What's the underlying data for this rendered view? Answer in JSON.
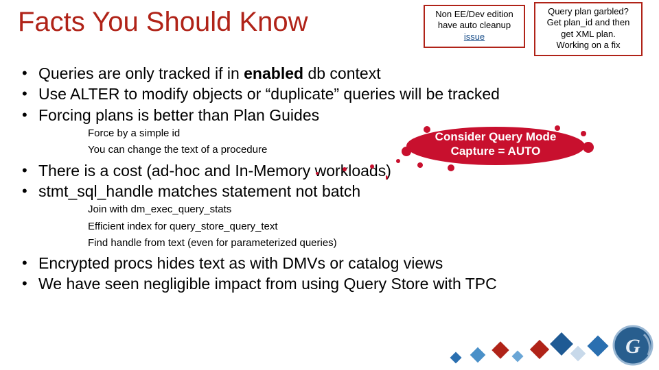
{
  "title": "Facts You Should Know",
  "callouts": {
    "ee_cleanup": {
      "line1": "Non EE/Dev edition",
      "line2": "have auto cleanup",
      "link": "issue"
    },
    "query_plan": {
      "line1": "Query plan garbled?",
      "line2": "Get plan_id and then",
      "line3": "get XML plan.",
      "line4": "Working on a fix"
    }
  },
  "splat": {
    "line1": "Consider Query Mode",
    "line2": "Capture = AUTO"
  },
  "bullets": {
    "b1_pre": "Queries are only tracked if in ",
    "b1_bold": "enabled",
    "b1_post": " db context",
    "b2": "Use ALTER to modify objects or “duplicate” queries will be tracked",
    "b3": "Forcing plans is better than Plan Guides",
    "b3_sub1": "Force by a simple id",
    "b3_sub2": "You can change the text of a procedure",
    "b4": "There is a cost (ad-hoc and In-Memory workloads)",
    "b5": "stmt_sql_handle matches statement not batch",
    "b5_sub1": "Join with dm_exec_query_stats",
    "b5_sub2": "Efficient index for query_store_query_text",
    "b5_sub3": "Find handle from text (even for parameterized queries)",
    "b6": "Encrypted procs hides text as with DMVs or catalog views",
    "b7": "We have seen negligible impact from using Query Store with TPC"
  }
}
